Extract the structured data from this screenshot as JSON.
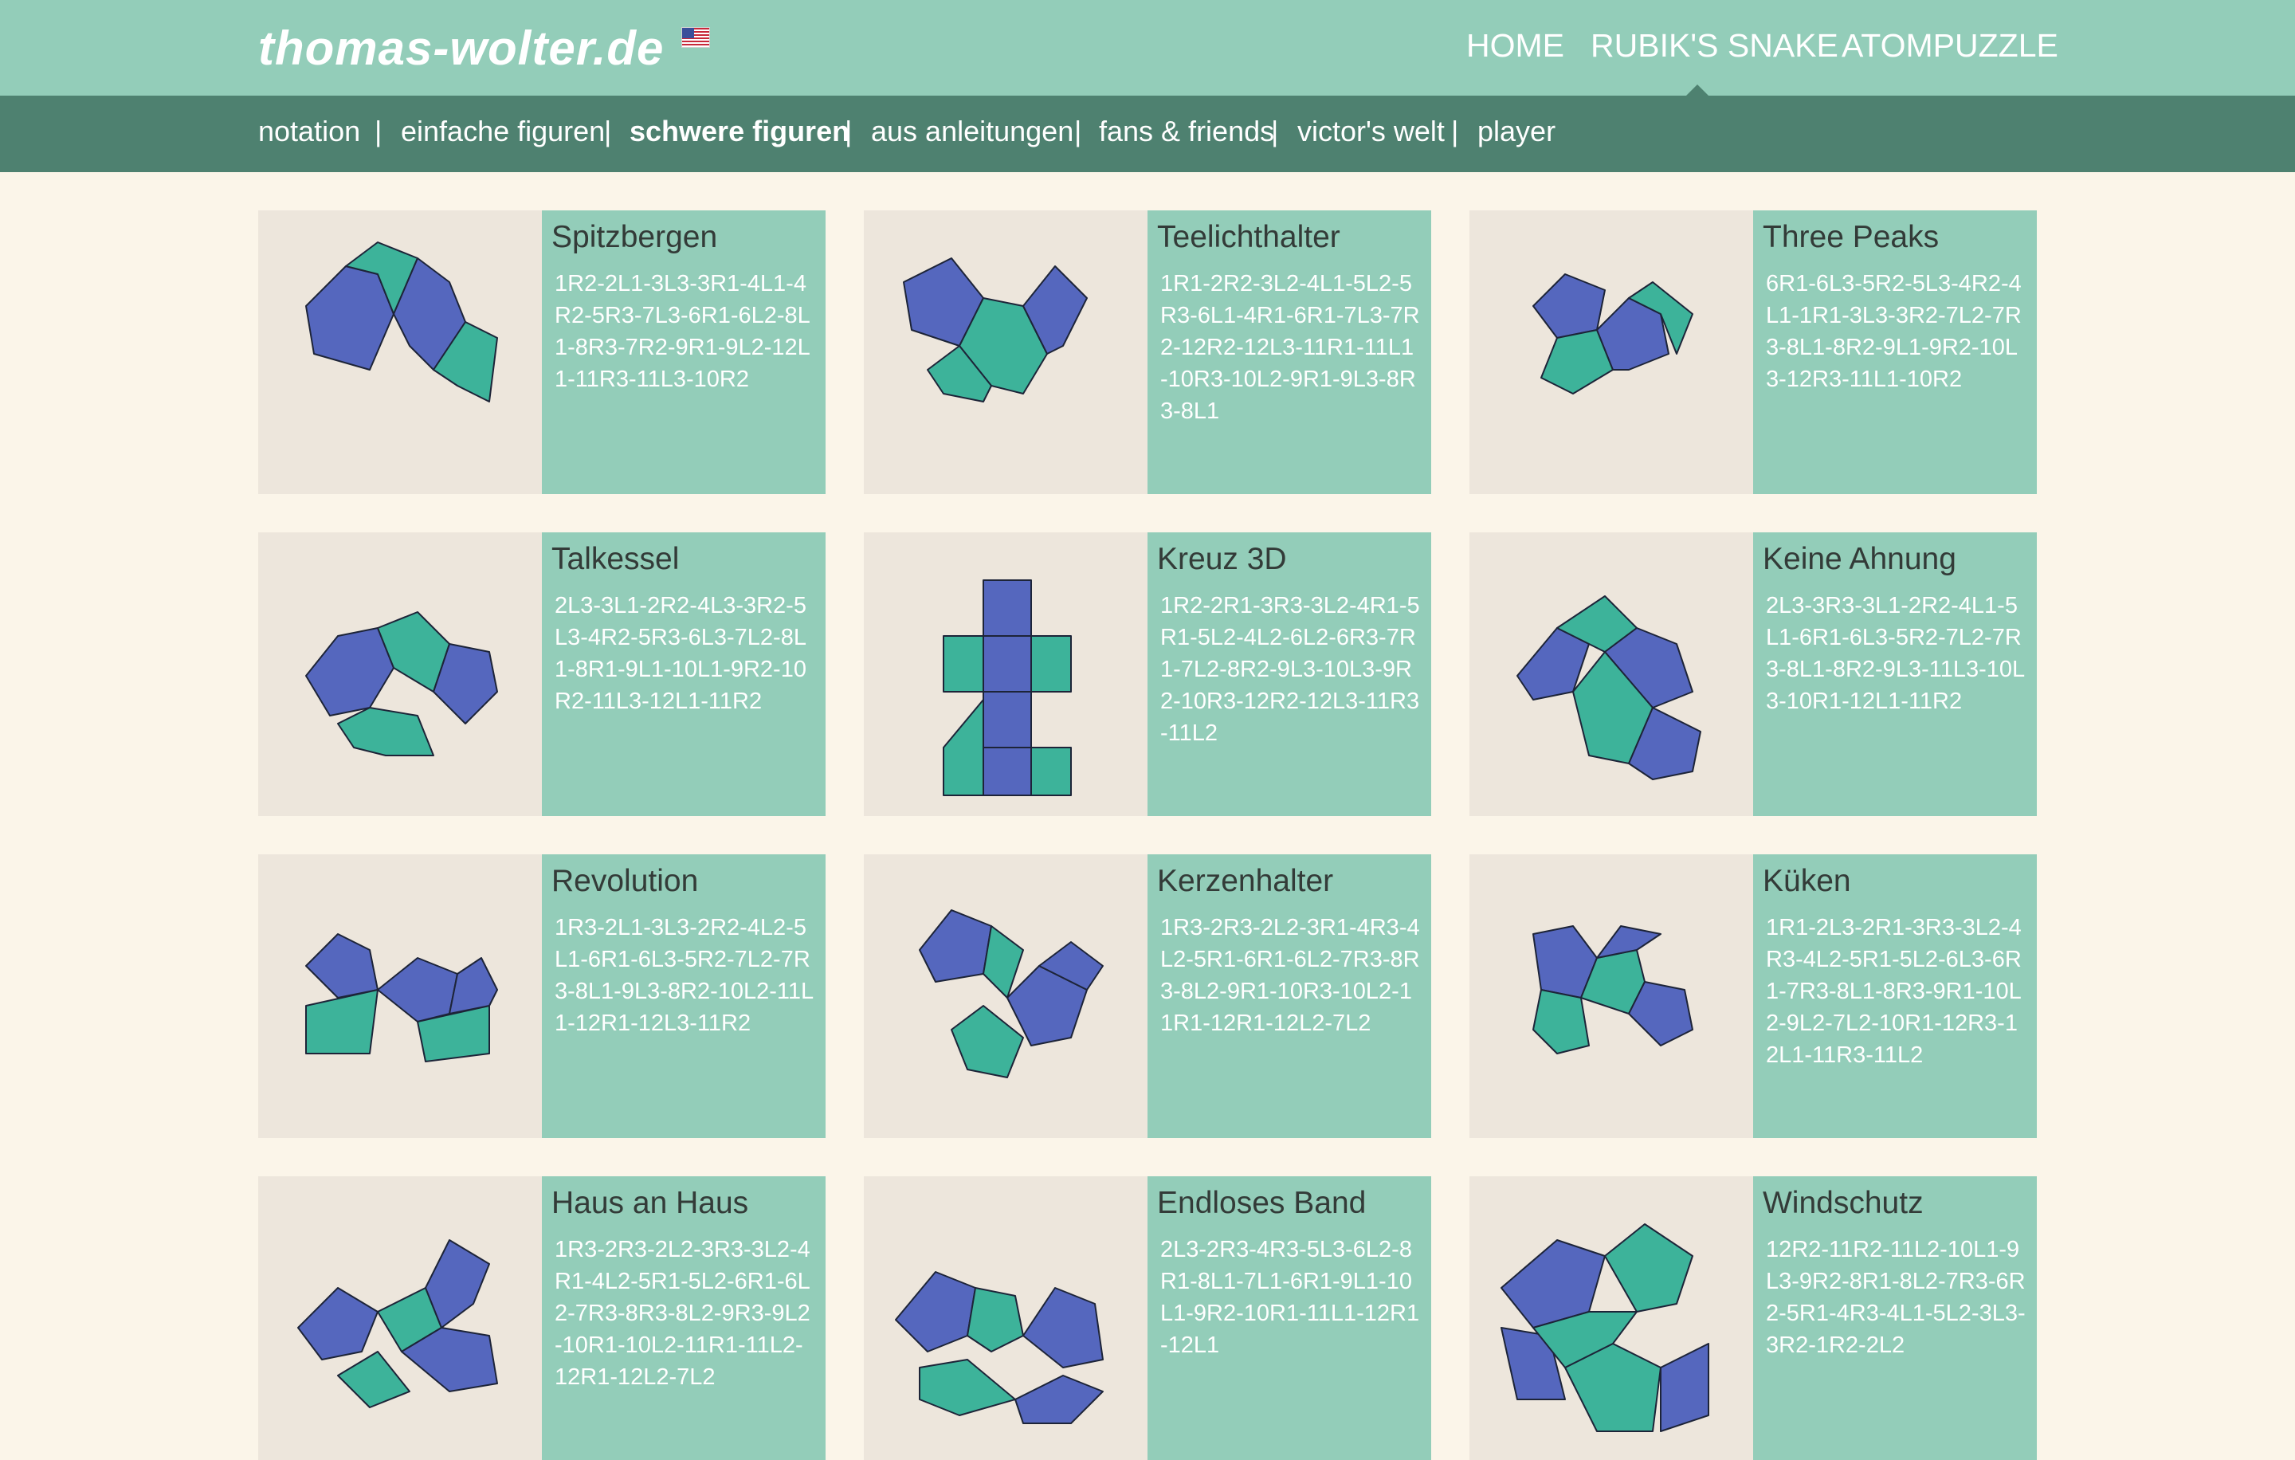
{
  "header": {
    "logo": "thomas-wolter.de",
    "language_flag": "us-flag-icon",
    "nav": [
      "HOME",
      "RUBIK'S SNAKE",
      "ATOMPUZZLE"
    ],
    "active_nav": "RUBIK'S SNAKE"
  },
  "subnav": {
    "items": [
      "notation",
      "einfache figuren",
      "schwere figuren",
      "aus anleitungen",
      "fans & friends",
      "victor's welt",
      "player"
    ],
    "separator": "|",
    "active": "schwere figuren"
  },
  "figures": [
    {
      "title": "Spitzbergen",
      "notation": "1R2-2L1-3L3-3R1-4L1-4R2-5R3-7L3-6R1-6L2-8L1-8R3-7R2-9R1-9L2-12L1-11R3-11L3-10R2"
    },
    {
      "title": "Teelichthalter",
      "notation": "1R1-2R2-3L2-4L1-5L2-5R3-6L1-4R1-6R1-7L3-7R2-12R2-12L3-11R1-11L1-10R3-10L2-9R1-9L3-8R3-8L1"
    },
    {
      "title": "Three Peaks",
      "notation": "6R1-6L3-5R2-5L3-4R2-4L1-1R1-3L3-3R2-7L2-7R3-8L1-8R2-9L1-9R2-10L3-12R3-11L1-10R2"
    },
    {
      "title": "Talkessel",
      "notation": "2L3-3L1-2R2-4L3-3R2-5L3-4R2-5R3-6L3-7L2-8L1-8R1-9L1-10L1-9R2-10R2-11L3-12L1-11R2"
    },
    {
      "title": "Kreuz 3D",
      "notation": "1R2-2R1-3R3-3L2-4R1-5R1-5L2-4L2-6L2-6R3-7R1-7L2-8R2-9L3-10L3-9R2-10R3-12R2-12L3-11R3-11L2"
    },
    {
      "title": "Keine Ahnung",
      "notation": "2L3-3R3-3L1-2R2-4L1-5L1-6R1-6L3-5R2-7L2-7R3-8L1-8R2-9L3-11L3-10L3-10R1-12L1-11R2"
    },
    {
      "title": "Revolution",
      "notation": "1R3-2L1-3L3-2R2-4L2-5L1-6R1-6L3-5R2-7L2-7R3-8L1-9L3-8R2-10L2-11L1-12R1-12L3-11R2"
    },
    {
      "title": "Kerzenhalter",
      "notation": "1R3-2R3-2L2-3R1-4R3-4L2-5R1-6R1-6L2-7R3-8R3-8L2-9R1-10R3-10L2-11R1-12R1-12L2-7L2"
    },
    {
      "title": "Küken",
      "notation": "1R1-2L3-2R1-3R3-3L2-4R3-4L2-5R1-5L2-6L3-6R1-7R3-8L1-8R3-9R1-10L2-9L2-7L2-10R1-12R3-12L1-11R3-11L2"
    },
    {
      "title": "Haus an Haus",
      "notation": "1R3-2R3-2L2-3R3-3L2-4R1-4L2-5R1-5L2-6R1-6L2-7R3-8R3-8L2-9R3-9L2-10R1-10L2-11R1-11L2-12R1-12L2-7L2"
    },
    {
      "title": "Endloses Band",
      "notation": "2L3-2R3-4R3-5L3-6L2-8R1-8L1-7L1-6R1-9L1-10L1-9R2-10R1-11L1-12R1-12L1"
    },
    {
      "title": "Windschutz",
      "notation": "12R2-11R2-11L2-10L1-9L3-9R2-8R1-8L2-7R3-6R2-5R1-4R3-4L1-5L2-3L3-3R2-1R2-2L2"
    }
  ],
  "colors": {
    "header_bg": "#93cdb9",
    "subnav_bg": "#4e8170",
    "page_bg": "#fbf5e9",
    "card_bg": "#93cdb9",
    "thumb_bg": "#ede6dc",
    "snake_blue": "#5567be",
    "snake_green": "#3db39a"
  }
}
